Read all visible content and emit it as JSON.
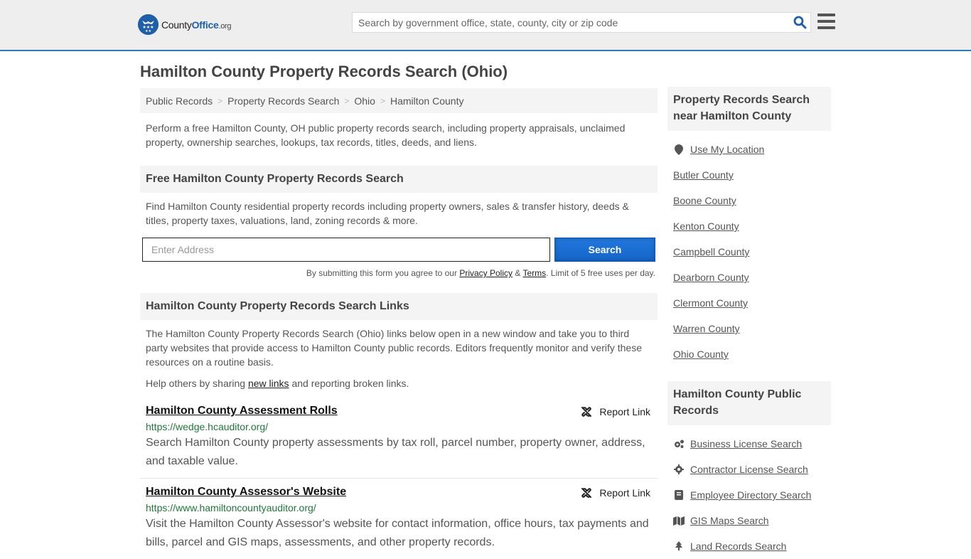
{
  "header": {
    "logo": {
      "brand_prefix": "County",
      "brand_main": "Office",
      "brand_suffix": ".org"
    },
    "search": {
      "placeholder": "Search by government office, state, county, city or zip code"
    },
    "colors": {
      "accent": "#2f79b8",
      "brand": "#1f5fa8"
    }
  },
  "page": {
    "title": "Hamilton County Property Records Search (Ohio)"
  },
  "breadcrumb": [
    {
      "label": "Public Records"
    },
    {
      "label": "Property Records Search"
    },
    {
      "label": "Ohio"
    },
    {
      "label": "Hamilton County"
    }
  ],
  "intro": "Perform a free Hamilton County, OH public property records search, including property appraisals, unclaimed property, ownership searches, lookups, tax records, titles, deeds, and liens.",
  "free_search": {
    "heading": "Free Hamilton County Property Records Search",
    "description": "Find Hamilton County residential property records including property owners, sales & transfer history, deeds & titles, property taxes, valuations, land, zoning records & more.",
    "address_placeholder": "Enter Address",
    "address_value": "",
    "button_label": "Search",
    "disclaimer_prefix": "By submitting this form you agree to our ",
    "privacy_label": "Privacy Policy",
    "amp": " & ",
    "terms_label": "Terms",
    "disclaimer_suffix": ". Limit of 5 free uses per day."
  },
  "links_section": {
    "heading": "Hamilton County Property Records Search Links",
    "description": "The Hamilton County Property Records Search (Ohio) links below open in a new window and take you to third party websites that provide access to Hamilton County public records. Editors frequently monitor and verify these resources on a routine basis.",
    "help_prefix": "Help others by sharing ",
    "help_link": "new links",
    "help_suffix": " and reporting broken links.",
    "report_label": "Report Link",
    "items": [
      {
        "title": "Hamilton County Assessment Rolls",
        "url": "https://wedge.hcauditor.org/",
        "description": "Search Hamilton County property assessments by tax roll, parcel number, property owner, address, and taxable value."
      },
      {
        "title": "Hamilton County Assessor's Website",
        "url": "https://www.hamiltoncountyauditor.org/",
        "description": "Visit the Hamilton County Assessor's website for contact information, office hours, tax payments and bills, parcel and GIS maps, assessments, and other property records."
      }
    ]
  },
  "sidebar": {
    "nearby": {
      "heading": "Property Records Search near Hamilton County",
      "use_location": "Use My Location",
      "counties": [
        "Butler County",
        "Boone County",
        "Kenton County",
        "Campbell County",
        "Dearborn County",
        "Clermont County",
        "Warren County",
        "Ohio County"
      ]
    },
    "public_records": {
      "heading": "Hamilton County Public Records",
      "items": [
        {
          "label": "Business License Search",
          "icon": "gears-icon"
        },
        {
          "label": "Contractor License Search",
          "icon": "gear-icon"
        },
        {
          "label": "Employee Directory Search",
          "icon": "book-icon"
        },
        {
          "label": "GIS Maps Search",
          "icon": "map-icon"
        },
        {
          "label": "Land Records Search",
          "icon": "tree-icon"
        }
      ]
    }
  }
}
